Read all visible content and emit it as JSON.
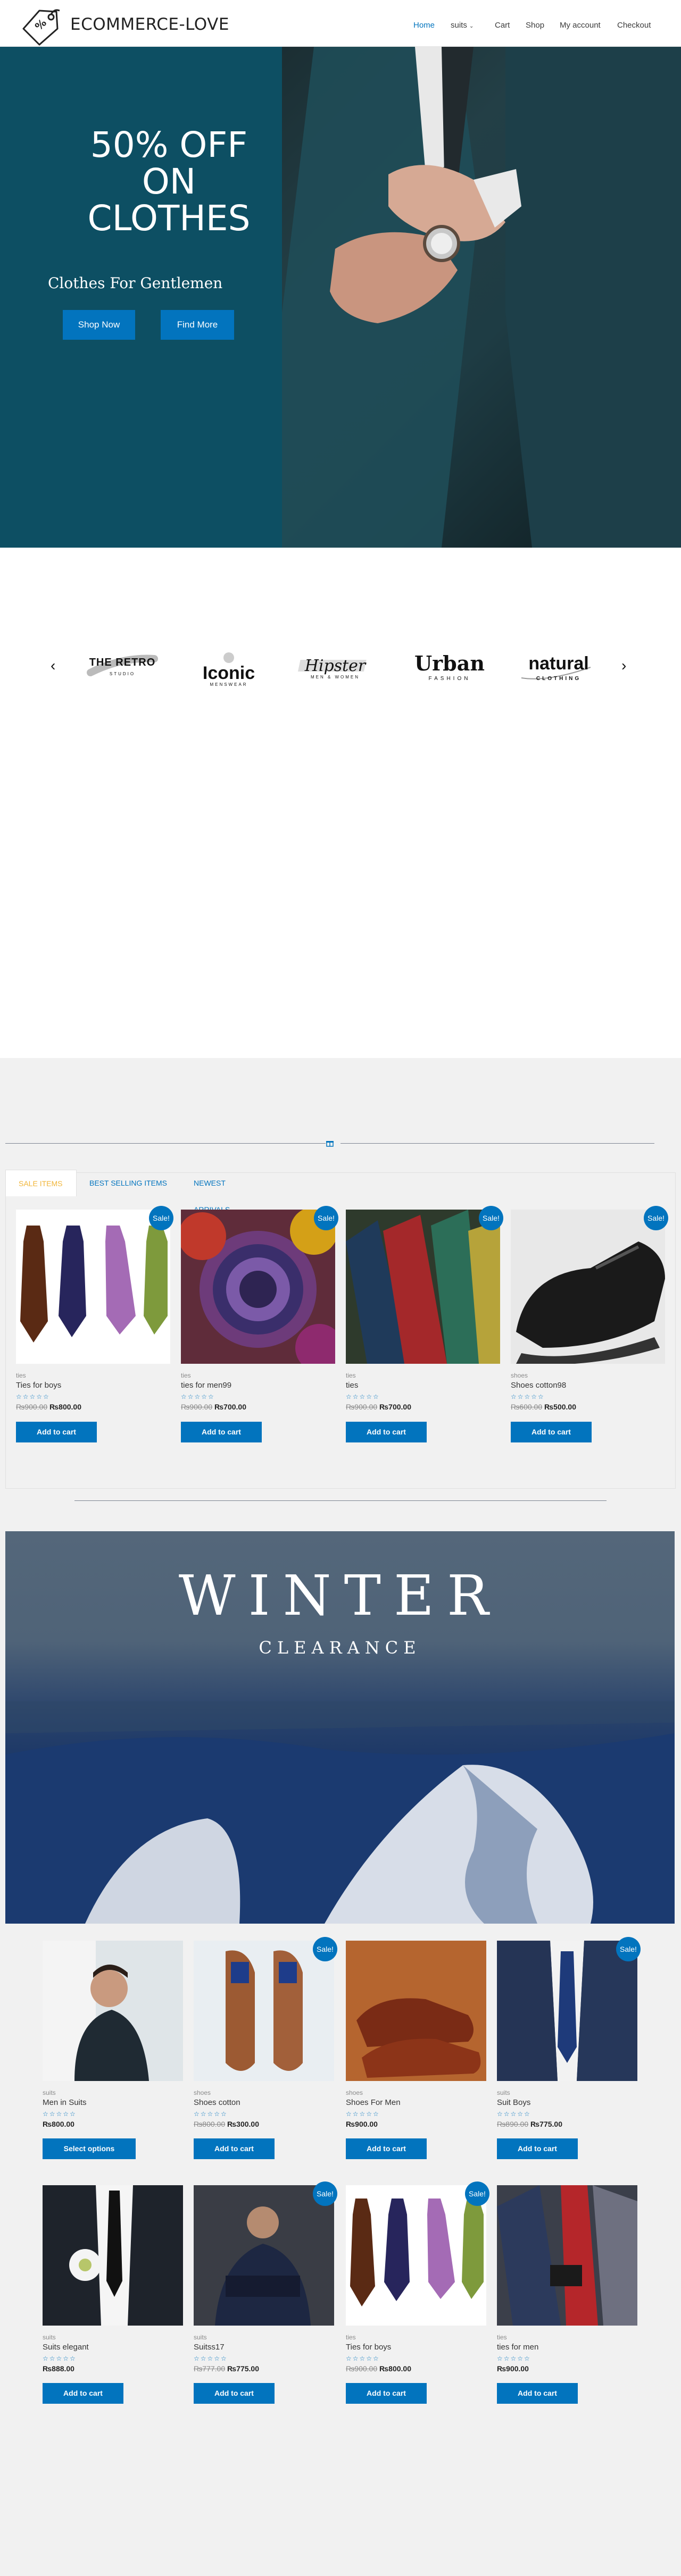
{
  "header": {
    "site_title": "ECOMMERCE-LOVE",
    "nav": [
      {
        "label": "Home"
      },
      {
        "label": "suits"
      },
      {
        "label": "Cart"
      },
      {
        "label": "Shop"
      },
      {
        "label": "My account"
      },
      {
        "label": "Checkout"
      }
    ]
  },
  "hero": {
    "headline": "50% OFF\nON\nCLOTHES",
    "subtitle": "Clothes For Gentlemen",
    "shop_now": "Shop Now",
    "find_more": "Find More"
  },
  "brands": {
    "logos": [
      {
        "name": "THE RETRO",
        "sub": "STUDIO"
      },
      {
        "name": "Iconic",
        "sub": "MENSWEAR"
      },
      {
        "name": "Hipster",
        "sub": "MEN & WOMEN"
      },
      {
        "name": "Urban",
        "sub": "FASHION"
      },
      {
        "name": "natural",
        "sub": "CLOTHING"
      }
    ],
    "prev": "‹",
    "next": "›"
  },
  "tabs": [
    "SALE ITEMS",
    "BEST SELLING ITEMS",
    "NEWEST ARRIVALS"
  ],
  "sale_products": [
    {
      "category": "ties",
      "name": "Ties for boys",
      "old_price": "₨900.00",
      "price": "₨800.00",
      "button": "Add to cart",
      "sale": "Sale!"
    },
    {
      "category": "ties",
      "name": "ties for men99",
      "old_price": "₨900.00",
      "price": "₨700.00",
      "button": "Add to cart",
      "sale": "Sale!"
    },
    {
      "category": "ties",
      "name": "ties",
      "old_price": "₨900.00",
      "price": "₨700.00",
      "button": "Add to cart",
      "sale": "Sale!"
    },
    {
      "category": "shoes",
      "name": "Shoes cotton98",
      "old_price": "₨600.00",
      "price": "₨500.00",
      "button": "Add to cart",
      "sale": "Sale!"
    }
  ],
  "winter": {
    "title": "WINTER",
    "subtitle": "CLEARANCE"
  },
  "grid_products": [
    {
      "category": "suits",
      "name": "Men in Suits",
      "old_price": "",
      "price": "₨800.00",
      "button": "Select options",
      "sale": ""
    },
    {
      "category": "shoes",
      "name": "Shoes cotton",
      "old_price": "₨800.00",
      "price": "₨300.00",
      "button": "Add to cart",
      "sale": "Sale!"
    },
    {
      "category": "shoes",
      "name": "Shoes For Men",
      "old_price": "",
      "price": "₨900.00",
      "button": "Add to cart",
      "sale": ""
    },
    {
      "category": "suits",
      "name": "Suit Boys",
      "old_price": "₨890.00",
      "price": "₨775.00",
      "button": "Add to cart",
      "sale": "Sale!"
    },
    {
      "category": "suits",
      "name": "Suits elegant",
      "old_price": "",
      "price": "₨888.00",
      "button": "Add to cart",
      "sale": ""
    },
    {
      "category": "suits",
      "name": "Suitss17",
      "old_price": "₨777.00",
      "price": "₨775.00",
      "button": "Add to cart",
      "sale": "Sale!"
    },
    {
      "category": "ties",
      "name": "Ties for boys",
      "old_price": "₨900.00",
      "price": "₨800.00",
      "button": "Add to cart",
      "sale": "Sale!"
    },
    {
      "category": "ties",
      "name": "ties for men",
      "old_price": "",
      "price": "₨900.00",
      "button": "Add to cart",
      "sale": ""
    }
  ],
  "rating": "☆☆☆☆☆",
  "colors": {
    "accent": "#0274be",
    "hero_teal": "#0d4f63",
    "tab_active": "#f1b63a"
  }
}
